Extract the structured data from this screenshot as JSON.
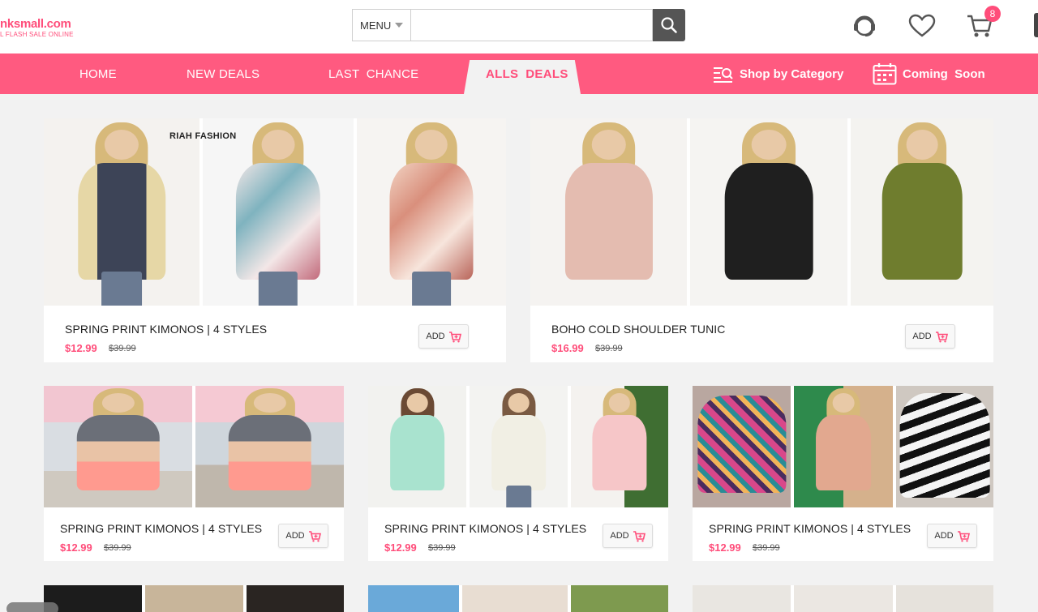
{
  "header": {
    "logo_main": "nksmall.com",
    "logo_sub": "L FLASH SALE ONLINE",
    "menu_label": "MENU",
    "search_placeholder": "",
    "cart_count": "8"
  },
  "nav": {
    "items": [
      "HOME",
      "NEW DEALS",
      "LAST  CHANCE"
    ],
    "active": "ALLS  DEALS",
    "shop_by_category": "Shop by Category",
    "coming_soon": "Coming  Soon"
  },
  "colors": {
    "accent": "#ff5a80",
    "price": "#ff4d7a"
  },
  "products": [
    {
      "title": "SPRING PRINT KIMONOS | 4 STYLES",
      "price": "$12.99",
      "old_price": "$39.99",
      "add_label": "ADD",
      "brand_mark": "RIAH FASHION"
    },
    {
      "title": "BOHO COLD SHOULDER TUNIC",
      "price": "$16.99",
      "old_price": "$39.99",
      "add_label": "ADD"
    },
    {
      "title": "SPRING PRINT KIMONOS | 4 STYLES",
      "price": "$12.99",
      "old_price": "$39.99",
      "add_label": "ADD"
    },
    {
      "title": "SPRING PRINT KIMONOS | 4 STYLES",
      "price": "$12.99",
      "old_price": "$39.99",
      "add_label": "ADD"
    },
    {
      "title": "SPRING PRINT KIMONOS | 4 STYLES",
      "price": "$12.99",
      "old_price": "$39.99",
      "add_label": "ADD"
    }
  ]
}
